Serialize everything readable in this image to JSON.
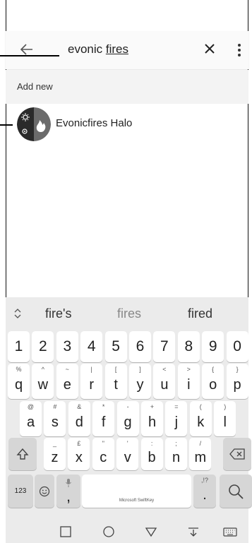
{
  "search": {
    "query_prefix": "evonic ",
    "query_underlined": "fires"
  },
  "add_new_label": "Add new",
  "result": {
    "label": "Evonicfires Halo"
  },
  "suggestions": [
    "fire's",
    "fires",
    "fired"
  ],
  "keyboard": {
    "numbers": [
      "1",
      "2",
      "3",
      "4",
      "5",
      "6",
      "7",
      "8",
      "9",
      "0"
    ],
    "row1": [
      {
        "sup": "%",
        "main": "q"
      },
      {
        "sup": "^",
        "main": "w"
      },
      {
        "sup": "~",
        "main": "e"
      },
      {
        "sup": "|",
        "main": "r"
      },
      {
        "sup": "[",
        "main": "t"
      },
      {
        "sup": "]",
        "main": "y"
      },
      {
        "sup": "<",
        "main": "u"
      },
      {
        "sup": ">",
        "main": "i"
      },
      {
        "sup": "{",
        "main": "o"
      },
      {
        "sup": "}",
        "main": "p"
      }
    ],
    "row2": [
      {
        "sup": "@",
        "main": "a"
      },
      {
        "sup": "#",
        "main": "s"
      },
      {
        "sup": "&",
        "main": "d"
      },
      {
        "sup": "*",
        "main": "f"
      },
      {
        "sup": "-",
        "main": "g"
      },
      {
        "sup": "+",
        "main": "h"
      },
      {
        "sup": "=",
        "main": "j"
      },
      {
        "sup": "(",
        "main": "k"
      },
      {
        "sup": ")",
        "main": "l"
      }
    ],
    "row3": [
      {
        "sup": "_",
        "main": "z"
      },
      {
        "sup": "£",
        "main": "x"
      },
      {
        "sup": "\"",
        "main": "c"
      },
      {
        "sup": "'",
        "main": "v"
      },
      {
        "sup": ":",
        "main": "b"
      },
      {
        "sup": ";",
        "main": "n"
      },
      {
        "sup": "/",
        "main": "m"
      }
    ],
    "num_switch_label": "123",
    "comma": ",",
    "period": ".",
    "period_sup": ",!?",
    "space_label": "Microsoft SwiftKey"
  },
  "colors": {
    "keyboard_bg": "#ebebeb",
    "key_bg": "#ffffff",
    "func_key_bg": "#d6d6d6"
  }
}
